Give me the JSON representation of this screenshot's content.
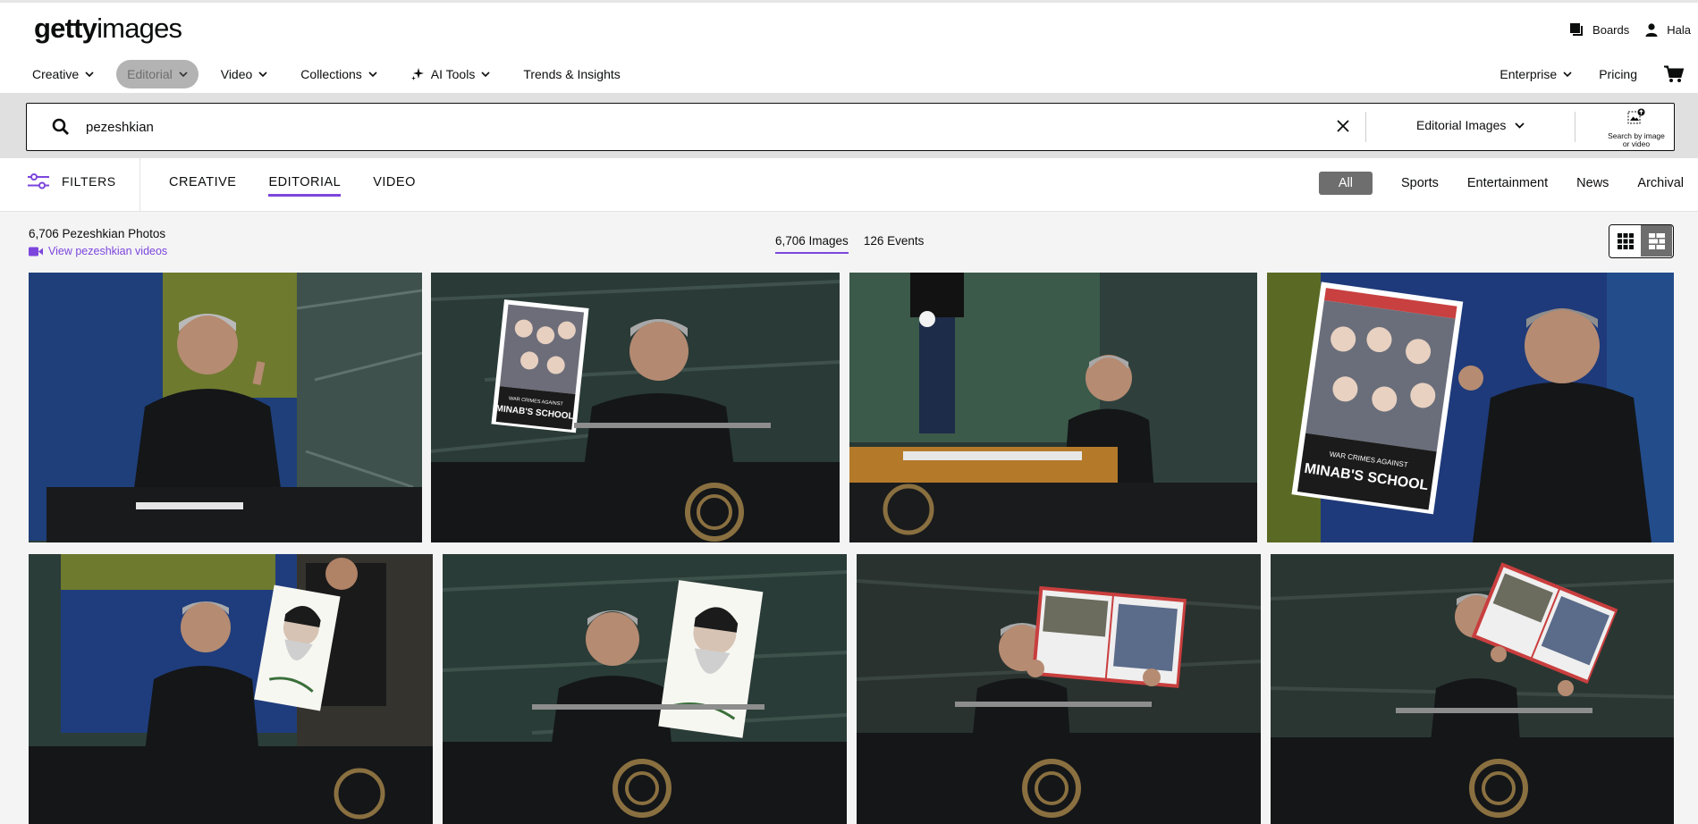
{
  "brand": {
    "logo_bold": "getty",
    "logo_light": "images"
  },
  "top_links": {
    "boards": "Boards",
    "user": "Hala"
  },
  "main_nav": [
    {
      "label": "Creative",
      "has_menu": true
    },
    {
      "label": "Editorial",
      "has_menu": true,
      "active": true
    },
    {
      "label": "Video",
      "has_menu": true
    },
    {
      "label": "Collections",
      "has_menu": true
    },
    {
      "label": "AI Tools",
      "has_menu": true
    },
    {
      "label": "Trends & Insights",
      "has_menu": false
    }
  ],
  "right_nav": {
    "enterprise": "Enterprise",
    "pricing": "Pricing"
  },
  "search": {
    "value": "pezeshkian",
    "image_type": "Editorial Images",
    "visual_search_label_1": "Search by image",
    "visual_search_label_2": "or video"
  },
  "filter_bar": {
    "filters_label": "FILTERS",
    "asset_tabs": [
      "CREATIVE",
      "EDITORIAL",
      "VIDEO"
    ],
    "active_asset_tab": "EDITORIAL",
    "categories": [
      "All",
      "Sports",
      "Entertainment",
      "News",
      "Archival"
    ],
    "active_category": "All"
  },
  "results": {
    "title": "6,706 Pezeshkian Photos",
    "videos_link": "View pezeshkian videos",
    "tabs": [
      "6,706 Images",
      "126 Events"
    ],
    "active_tab": "6,706 Images"
  },
  "icons": {
    "search": "search-icon",
    "clear": "close-icon",
    "boards": "boards-icon",
    "user": "user-icon",
    "cart": "cart-icon",
    "filters": "sliders-icon",
    "video": "video-camera-icon",
    "grid": "grid-view-icon",
    "mosaic": "mosaic-view-icon",
    "visual_search": "camera-search-icon",
    "ai_tools": "sparkle-icon"
  },
  "colors": {
    "accent": "#7c46dd",
    "text": "#0c0d0d",
    "active_pill": "#6e6e6e",
    "page_bg": "#f4f4f4"
  },
  "image_tiles": [
    {
      "poster_text_1": "",
      "poster_text_2": ""
    },
    {
      "poster_text_1": "WAR CRIMES AGAINST",
      "poster_text_2": "MINAB'S SCHOOL"
    },
    {
      "poster_text_1": "",
      "poster_text_2": ""
    },
    {
      "poster_text_1": "WAR CRIMES AGAINST",
      "poster_text_2": "MINAB'S SCHOOL"
    },
    {
      "poster_text_1": "",
      "poster_text_2": ""
    },
    {
      "poster_text_1": "",
      "poster_text_2": ""
    },
    {
      "poster_text_1": "",
      "poster_text_2": ""
    },
    {
      "poster_text_1": "",
      "poster_text_2": ""
    }
  ]
}
